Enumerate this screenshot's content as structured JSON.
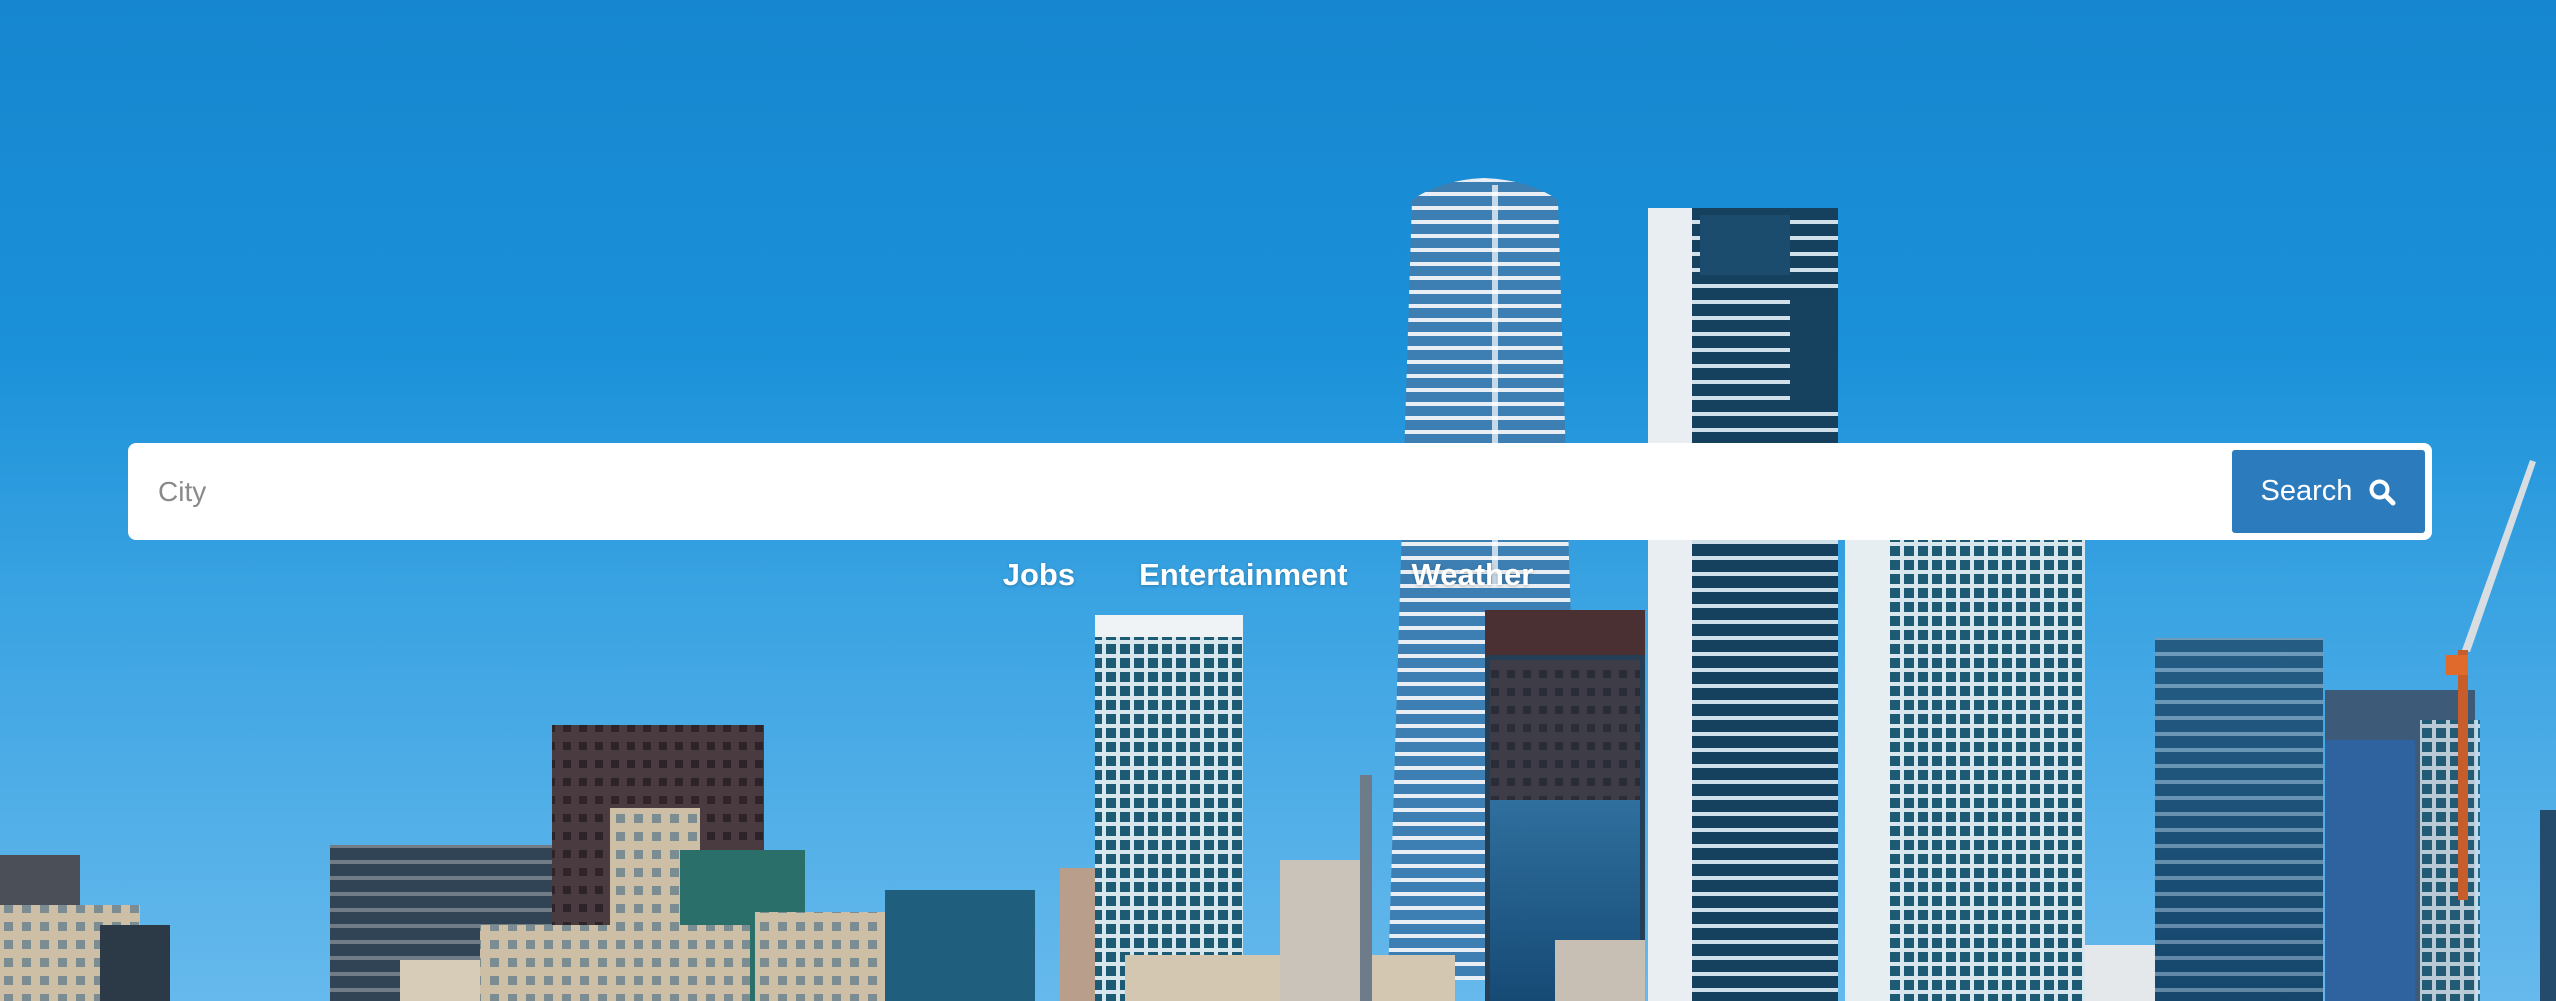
{
  "search": {
    "placeholder": "City",
    "value": "",
    "button_label": "Search",
    "button_icon": "search-icon",
    "button_color": "#2b7bbd"
  },
  "nav": {
    "items": [
      {
        "label": "Jobs"
      },
      {
        "label": "Entertainment"
      },
      {
        "label": "Weather"
      }
    ]
  },
  "background": {
    "description_icon": "city-skyline-image",
    "sky_color": "#1586cf"
  }
}
